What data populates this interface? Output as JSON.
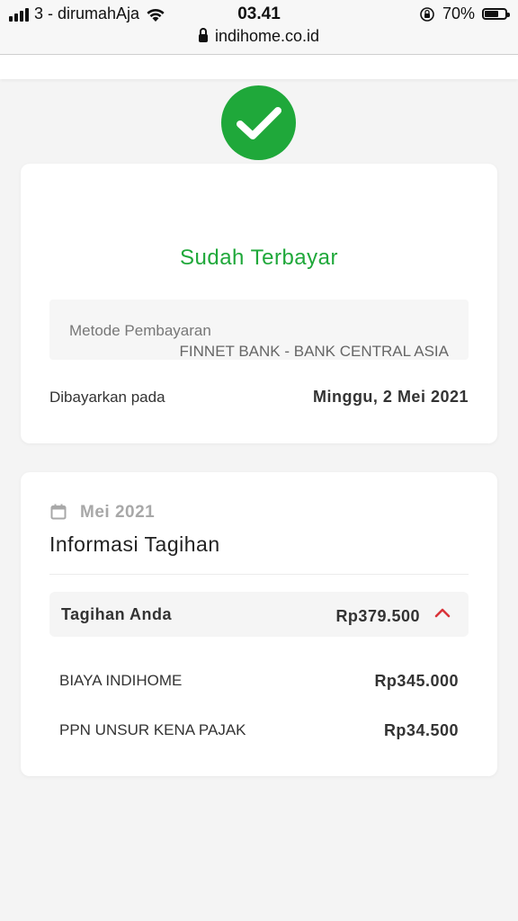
{
  "status_bar": {
    "carrier": "3 - dirumahAja",
    "time": "03.41",
    "battery": "70%",
    "battery_level": 0.7,
    "url": "indihome.co.id"
  },
  "icons": {
    "signal": "signal-icon",
    "wifi": "wifi-icon",
    "orientation_lock": "orientation-lock-icon",
    "battery": "battery-icon",
    "lock": "lock-icon",
    "success": "checkmark-circle-icon",
    "calendar": "calendar-icon",
    "collapse": "chevron-up-icon"
  },
  "colors": {
    "success": "#1fa83a",
    "chevron": "#d9343a"
  },
  "payment": {
    "status": "Sudah Terbayar",
    "method_label": "Metode Pembayaran",
    "method_value": "FINNET BANK - BANK CENTRAL ASIA",
    "paid_label": "Dibayarkan pada",
    "paid_date": "Minggu, 2 Mei 2021"
  },
  "billing": {
    "period": "Mei 2021",
    "title": "Informasi Tagihan",
    "summary_label": "Tagihan Anda",
    "summary_total": "Rp379.500",
    "items": [
      {
        "label": "BIAYA INDIHOME",
        "amount": "Rp345.000"
      },
      {
        "label": "PPN UNSUR KENA PAJAK",
        "amount": "Rp34.500"
      }
    ]
  }
}
